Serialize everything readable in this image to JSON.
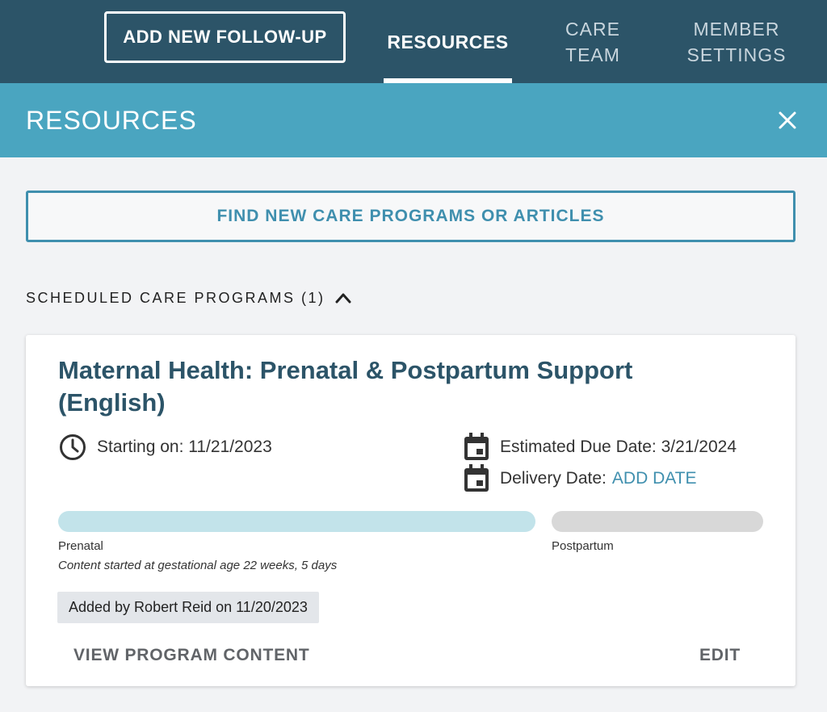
{
  "topnav": {
    "follow_up_label": "ADD NEW FOLLOW-UP",
    "tabs": [
      {
        "label": "RESOURCES",
        "active": true
      },
      {
        "label": "CARE\nTEAM",
        "active": false
      },
      {
        "label": "MEMBER\nSETTINGS",
        "active": false
      }
    ],
    "background_color": "#2c5468"
  },
  "panel": {
    "title": "RESOURCES",
    "close_icon": "close-icon",
    "header_color": "#4aa5c0"
  },
  "find_button": {
    "label": "FIND NEW CARE PROGRAMS OR ARTICLES",
    "color": "#3f8fae"
  },
  "section": {
    "label": "SCHEDULED CARE PROGRAMS (1)",
    "expanded": true,
    "toggle_icon": "chevron-up-icon"
  },
  "program": {
    "title": "Maternal Health: Prenatal & Postpartum Support (English)",
    "starting_text": "Starting on: 11/21/2023",
    "due_text": "Estimated Due Date: 3/21/2024",
    "delivery_label": "Delivery Date:",
    "delivery_action": "ADD DATE",
    "stages": [
      {
        "label": "Prenatal",
        "color": "#c2e3ea"
      },
      {
        "label": "Postpartum",
        "color": "#d8d8d8"
      }
    ],
    "stage_note": "Content started at gestational age 22 weeks, 5 days",
    "added_by": "Added by Robert Reid on 11/20/2023",
    "view_label": "VIEW PROGRAM CONTENT",
    "edit_label": "EDIT"
  }
}
